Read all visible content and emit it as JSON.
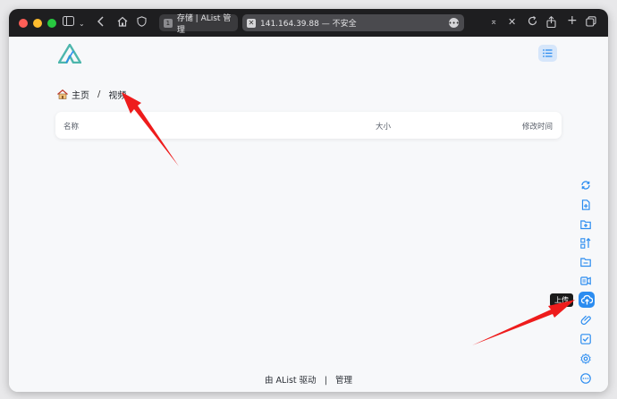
{
  "browser": {
    "tab1_badge": "1",
    "tab1_title": "存储 | AList 管理",
    "tab2_title": "141.164.39.88 — 不安全"
  },
  "breadcrumb": {
    "home": "主页",
    "separator": "/",
    "current": "视频"
  },
  "table": {
    "columns": [
      "名称",
      "大小",
      "修改时间"
    ]
  },
  "sidebar": {
    "tooltip": "上传",
    "icons": [
      "refresh-icon",
      "new-file-icon",
      "new-folder-icon",
      "sort-icon",
      "local-folder-icon",
      "offline-download-icon",
      "upload-icon",
      "link-icon",
      "select-icon",
      "settings-icon",
      "more-icon"
    ]
  },
  "footer": {
    "powered": "由 AList 驱动",
    "divider": "|",
    "manage": "管理"
  },
  "colors": {
    "accent": "#2b8cf0",
    "logo": "#4db6ac",
    "arrow": "#ee1c1c"
  }
}
